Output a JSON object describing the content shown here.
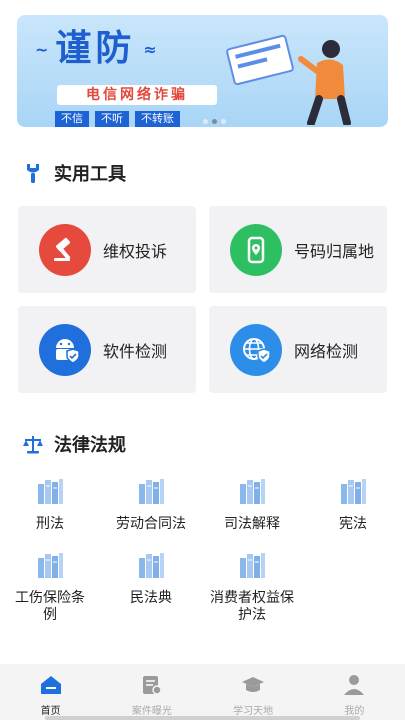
{
  "banner": {
    "deco_left": "~",
    "title": "谨防",
    "deco_right": "≈",
    "subtitle": "电信网络诈骗",
    "tags": [
      "不信",
      "不听",
      "不转账"
    ],
    "accent": "#1e5fcf"
  },
  "tools_section": {
    "title": "实用工具",
    "icon": "tool-icon"
  },
  "tools": [
    {
      "label": "维权投诉",
      "icon": "gavel-icon",
      "color": "#e64a3c"
    },
    {
      "label": "号码归属地",
      "icon": "phone-location-icon",
      "color": "#2fbf63"
    },
    {
      "label": "软件检测",
      "icon": "android-shield-icon",
      "color": "#1f6fdc"
    },
    {
      "label": "网络检测",
      "icon": "globe-shield-icon",
      "color": "#2c8ee8"
    }
  ],
  "laws_section": {
    "title": "法律法规",
    "icon": "scales-icon"
  },
  "laws": [
    {
      "label": "刑法"
    },
    {
      "label": "劳动合同法"
    },
    {
      "label": "司法解释"
    },
    {
      "label": "宪法"
    },
    {
      "label": "工伤保险条例"
    },
    {
      "label": "民法典"
    },
    {
      "label": "消费者权益保护法"
    }
  ],
  "nav": [
    {
      "label": "首页",
      "icon": "home-icon",
      "active": true
    },
    {
      "label": "案件曝光",
      "icon": "case-icon",
      "active": false
    },
    {
      "label": "学习天地",
      "icon": "graduation-cap-icon",
      "active": false
    },
    {
      "label": "我的",
      "icon": "user-icon",
      "active": false
    }
  ]
}
